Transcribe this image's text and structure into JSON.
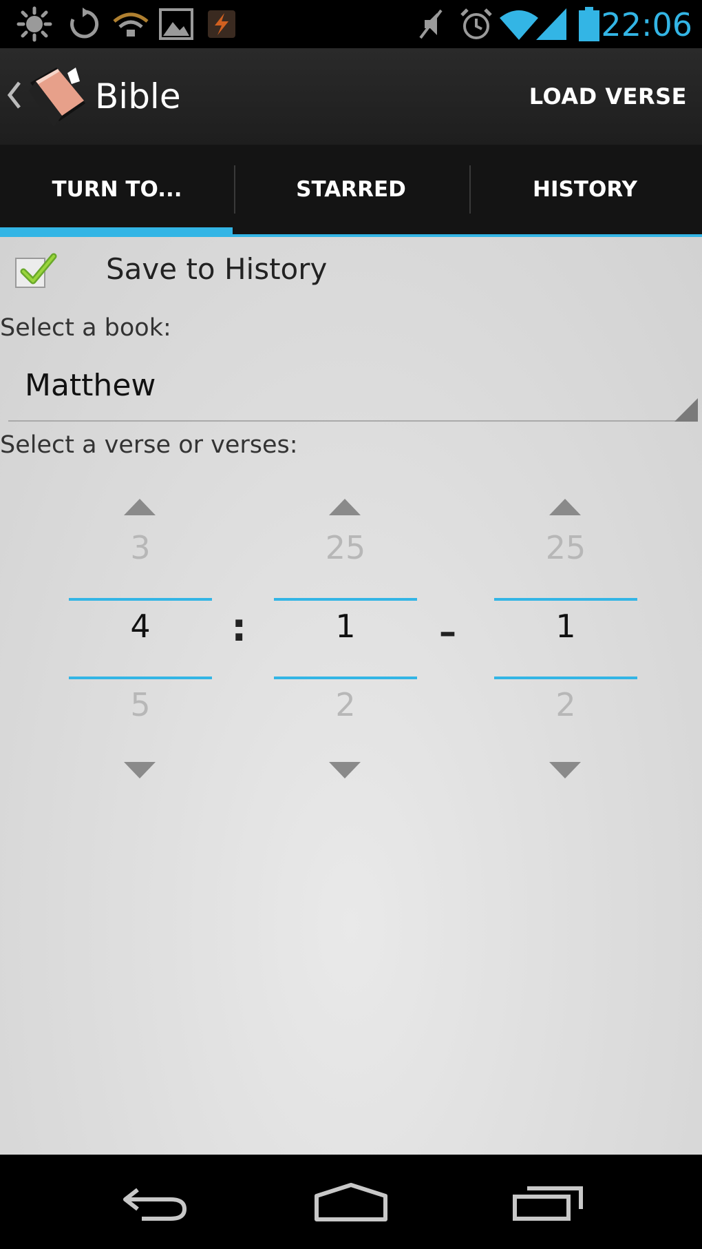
{
  "status_bar": {
    "time": "22:06",
    "left_icons": [
      "brightness-icon",
      "sync-icon",
      "podcast-icon",
      "gallery-icon",
      "flash-icon"
    ],
    "right_icons": [
      "mute-icon",
      "alarm-icon",
      "wifi-icon",
      "signal-icon",
      "battery-icon"
    ],
    "accent_color": "#33b5e5"
  },
  "action_bar": {
    "title": "Bible",
    "action_label": "LOAD VERSE"
  },
  "tabs": [
    {
      "label": "TURN TO...",
      "selected": true
    },
    {
      "label": "STARRED",
      "selected": false
    },
    {
      "label": "HISTORY",
      "selected": false
    }
  ],
  "form": {
    "save_history": {
      "label": "Save to History",
      "checked": true
    },
    "book_label": "Select a book:",
    "book_value": "Matthew",
    "verse_label": "Select a verse or verses:",
    "pickers": [
      {
        "name": "chapter",
        "prev": "3",
        "current": "4",
        "next": "5"
      },
      {
        "name": "verse-start",
        "prev": "25",
        "current": "1",
        "next": "2"
      },
      {
        "name": "verse-end",
        "prev": "25",
        "current": "1",
        "next": "2"
      }
    ],
    "separator_colon": ":",
    "separator_dash": "–"
  },
  "nav_bar": {
    "buttons": [
      "back-icon",
      "home-icon",
      "recent-apps-icon"
    ]
  }
}
